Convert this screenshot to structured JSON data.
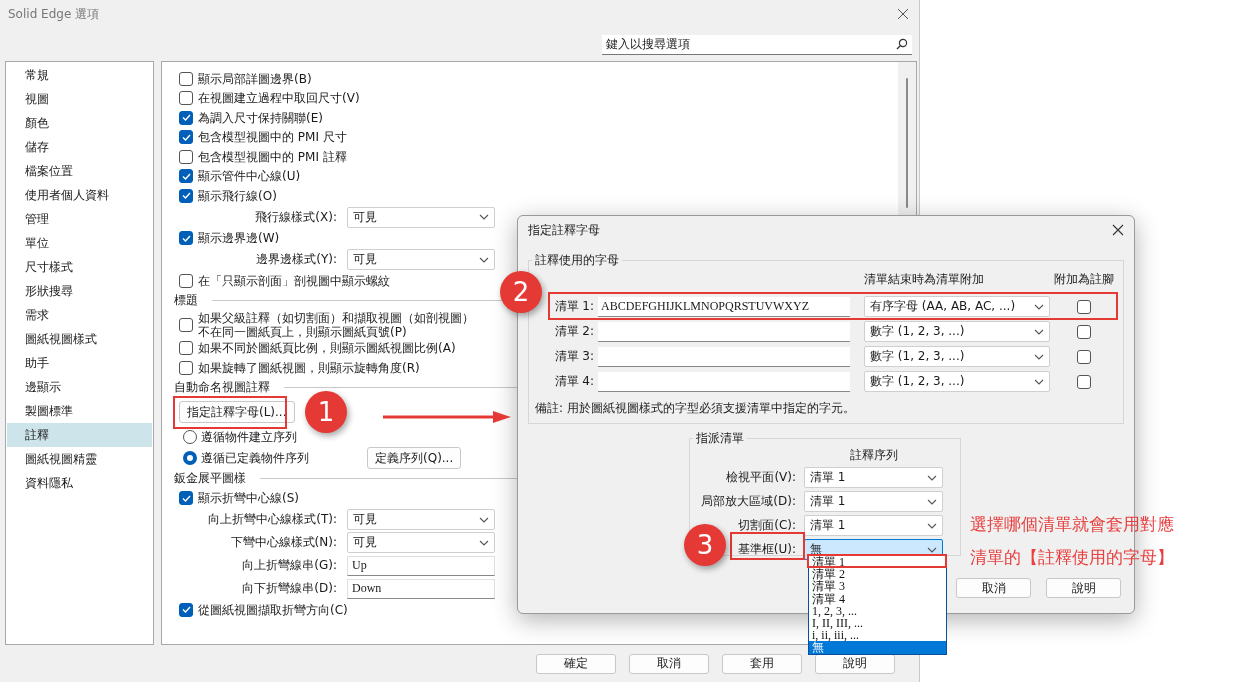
{
  "window": {
    "title": "Solid Edge 選項"
  },
  "search": {
    "placeholder": "鍵入以搜尋選項"
  },
  "sidebar": {
    "items": [
      {
        "label": "常規",
        "selected": false
      },
      {
        "label": "視圖",
        "selected": false
      },
      {
        "label": "顏色",
        "selected": false
      },
      {
        "label": "儲存",
        "selected": false
      },
      {
        "label": "檔案位置",
        "selected": false
      },
      {
        "label": "使用者個人資料",
        "selected": false
      },
      {
        "label": "管理",
        "selected": false
      },
      {
        "label": "單位",
        "selected": false
      },
      {
        "label": "尺寸樣式",
        "selected": false
      },
      {
        "label": "形狀搜尋",
        "selected": false
      },
      {
        "label": "需求",
        "selected": false
      },
      {
        "label": "圖紙視圖樣式",
        "selected": false
      },
      {
        "label": "助手",
        "selected": false
      },
      {
        "label": "邊顯示",
        "selected": false
      },
      {
        "label": "製圖標準",
        "selected": false
      },
      {
        "label": "註釋",
        "selected": true
      },
      {
        "label": "圖紙視圖精靈",
        "selected": false
      },
      {
        "label": "資料隱私",
        "selected": false
      }
    ]
  },
  "options": [
    {
      "kind": "checkbox",
      "label": "顯示局部詳圖邊界(B)",
      "checked": false
    },
    {
      "kind": "checkbox",
      "label": "在視圖建立過程中取回尺寸(V)",
      "checked": false
    },
    {
      "kind": "checkbox",
      "label": "為調入尺寸保持關聯(E)",
      "checked": true
    },
    {
      "kind": "checkbox",
      "label": "包含模型視圖中的 PMI 尺寸",
      "checked": true
    },
    {
      "kind": "checkbox",
      "label": "包含模型視圖中的 PMI 註釋",
      "checked": false
    },
    {
      "kind": "checkbox",
      "label": "顯示管件中心線(U)",
      "checked": true
    },
    {
      "kind": "checkbox",
      "label": "顯示飛行線(O)",
      "checked": true
    },
    {
      "kind": "select",
      "label": "飛行線樣式(X):",
      "value": "可見"
    },
    {
      "kind": "checkbox",
      "label": "顯示邊界邊(W)",
      "checked": true
    },
    {
      "kind": "select",
      "label": "邊界邊樣式(Y):",
      "value": "可見"
    },
    {
      "kind": "checkbox",
      "label": "在「只顯示剖面」剖視圖中顯示螺紋",
      "checked": false
    },
    {
      "kind": "heading",
      "label": "標題"
    },
    {
      "kind": "checkbox",
      "label": "如果父級註釋（如切割面）和擷取視圖（如剖視圖）不在同一圖紙頁上，則顯示圖紙頁號(P)",
      "checked": false
    },
    {
      "kind": "checkbox",
      "label": "如果不同於圖紙頁比例，則顯示圖紙視圖比例(A)",
      "checked": false
    },
    {
      "kind": "checkbox",
      "label": "如果旋轉了圖紙視圖，則顯示旋轉角度(R)",
      "checked": false
    },
    {
      "kind": "heading",
      "label": "自動命名視圖註釋"
    },
    {
      "kind": "button",
      "label": "指定註釋字母(L)..."
    },
    {
      "kind": "radio",
      "label": "遵循物件建立序列",
      "selected": false
    },
    {
      "kind": "radio",
      "label": "遵循已定義物件序列",
      "selected": true,
      "button": "定義序列(Q)..."
    },
    {
      "kind": "heading",
      "label": "鈑金展平圖樣"
    },
    {
      "kind": "checkbox",
      "label": "顯示折彎中心線(S)",
      "checked": true
    },
    {
      "kind": "select",
      "label": "向上折彎中心線樣式(T):",
      "value": "可見"
    },
    {
      "kind": "select",
      "label": "下彎中心線樣式(N):",
      "value": "可見"
    },
    {
      "kind": "text",
      "label": "向上折彎線串(G):",
      "value": "Up"
    },
    {
      "kind": "text",
      "label": "向下折彎線串(D):",
      "value": "Down"
    },
    {
      "kind": "checkbox",
      "label": "從圖紙視圖擷取折彎方向(C)",
      "checked": true
    }
  ],
  "footer": {
    "buttons": [
      "確定",
      "取消",
      "套用",
      "說明"
    ]
  },
  "dialog": {
    "title": "指定註釋字母",
    "letters": {
      "title": "註釋使用的字母",
      "columns": [
        "清單結束時為清單附加",
        "附加為註腳"
      ],
      "lists": [
        {
          "label": "清單 1:",
          "value": "ABCDEFGHIJKLMNOPQRSTUVWXYZ",
          "append": "有序字母 (AA, AB, AC, ...)",
          "footnote": false
        },
        {
          "label": "清單 2:",
          "append": "數字 (1, 2, 3, ...)",
          "footnote": false
        },
        {
          "label": "清單 3:",
          "append": "數字 (1, 2, 3, ...)",
          "footnote": false
        },
        {
          "label": "清單 4:",
          "append": "數字 (1, 2, 3, ...)",
          "footnote": false
        }
      ],
      "note": "備註: 用於圖紙視圖樣式的字型必須支援清單中指定的字元。"
    },
    "assign": {
      "title": "指派清單",
      "column": "註釋序列",
      "rows": [
        {
          "label": "檢視平面(V):",
          "value": "清單 1",
          "focused": false
        },
        {
          "label": "局部放大區域(D):",
          "value": "清單 1",
          "focused": false
        },
        {
          "label": "切割面(C):",
          "value": "清單 1",
          "focused": false
        },
        {
          "label": "基準框(U):",
          "value": "無",
          "focused": true
        }
      ]
    },
    "dropdown": {
      "items": [
        {
          "label": "清單 1",
          "selected": false
        },
        {
          "label": "清單 2",
          "selected": false
        },
        {
          "label": "清單 3",
          "selected": false
        },
        {
          "label": "清單 4",
          "selected": false
        },
        {
          "label": "1, 2, 3, ...",
          "selected": false
        },
        {
          "label": "I, II, III, ...",
          "selected": false
        },
        {
          "label": "i, ii, iii, ...",
          "selected": false
        },
        {
          "label": "無",
          "selected": true
        }
      ]
    },
    "buttons": [
      "取消",
      "說明"
    ]
  },
  "annotations": {
    "markers": [
      "1",
      "2",
      "3"
    ],
    "note": [
      "選擇哪個清單就會套用對應",
      "清單的【註釋使用的字母】"
    ]
  }
}
